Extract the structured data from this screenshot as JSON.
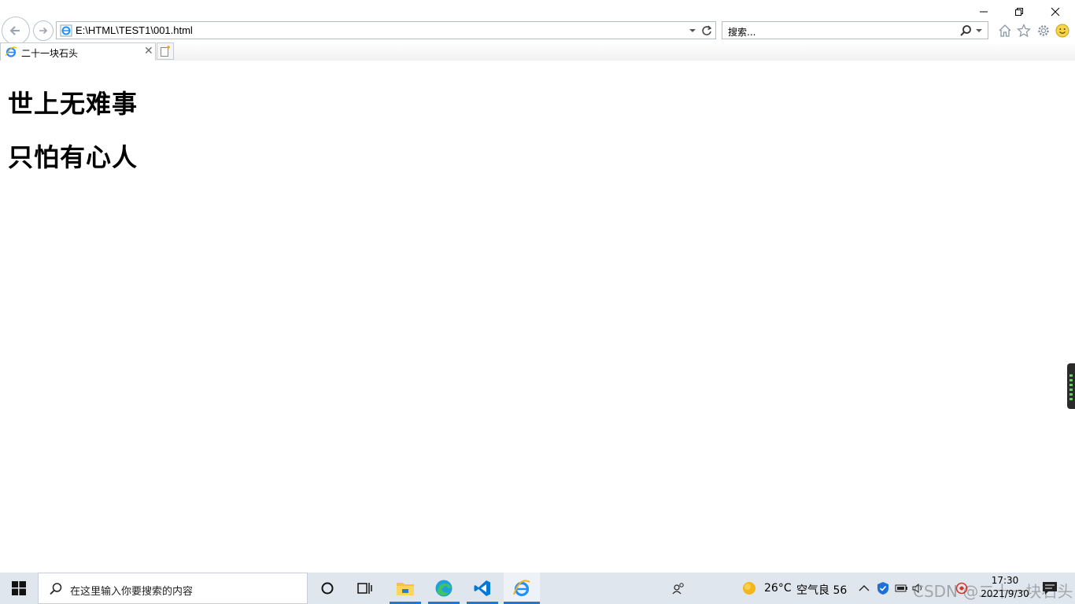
{
  "browser": {
    "address_url": "E:\\HTML\\TEST1\\001.html",
    "search_placeholder": "搜索...",
    "tab_title": "二十一块石头"
  },
  "page": {
    "line1": "世上无难事",
    "line2": "只怕有心人"
  },
  "taskbar": {
    "search_placeholder": "在这里输入你要搜索的内容",
    "weather_temp": "26°C",
    "air_quality": "空气良 56",
    "time": "17:30",
    "date": "2021/9/30",
    "watermark": "CSDN @二十一块石头"
  },
  "colors": {
    "taskbar_bg": "#dfe6ee",
    "active_indicator": "#1f78d1",
    "ie_blue": "#1e90ff",
    "vscode_blue": "#0078d4"
  },
  "icons": {
    "nav": [
      "back-arrow-icon",
      "forward-arrow-icon",
      "refresh-icon",
      "search-icon"
    ],
    "toolbar": [
      "home-icon",
      "favorites-star-icon",
      "settings-gear-icon",
      "feedback-smiley-icon"
    ],
    "taskbar": [
      "windows-start-icon",
      "cortana-icon",
      "task-view-icon",
      "file-explorer-icon",
      "edge-icon",
      "vscode-icon",
      "internet-explorer-icon"
    ]
  }
}
